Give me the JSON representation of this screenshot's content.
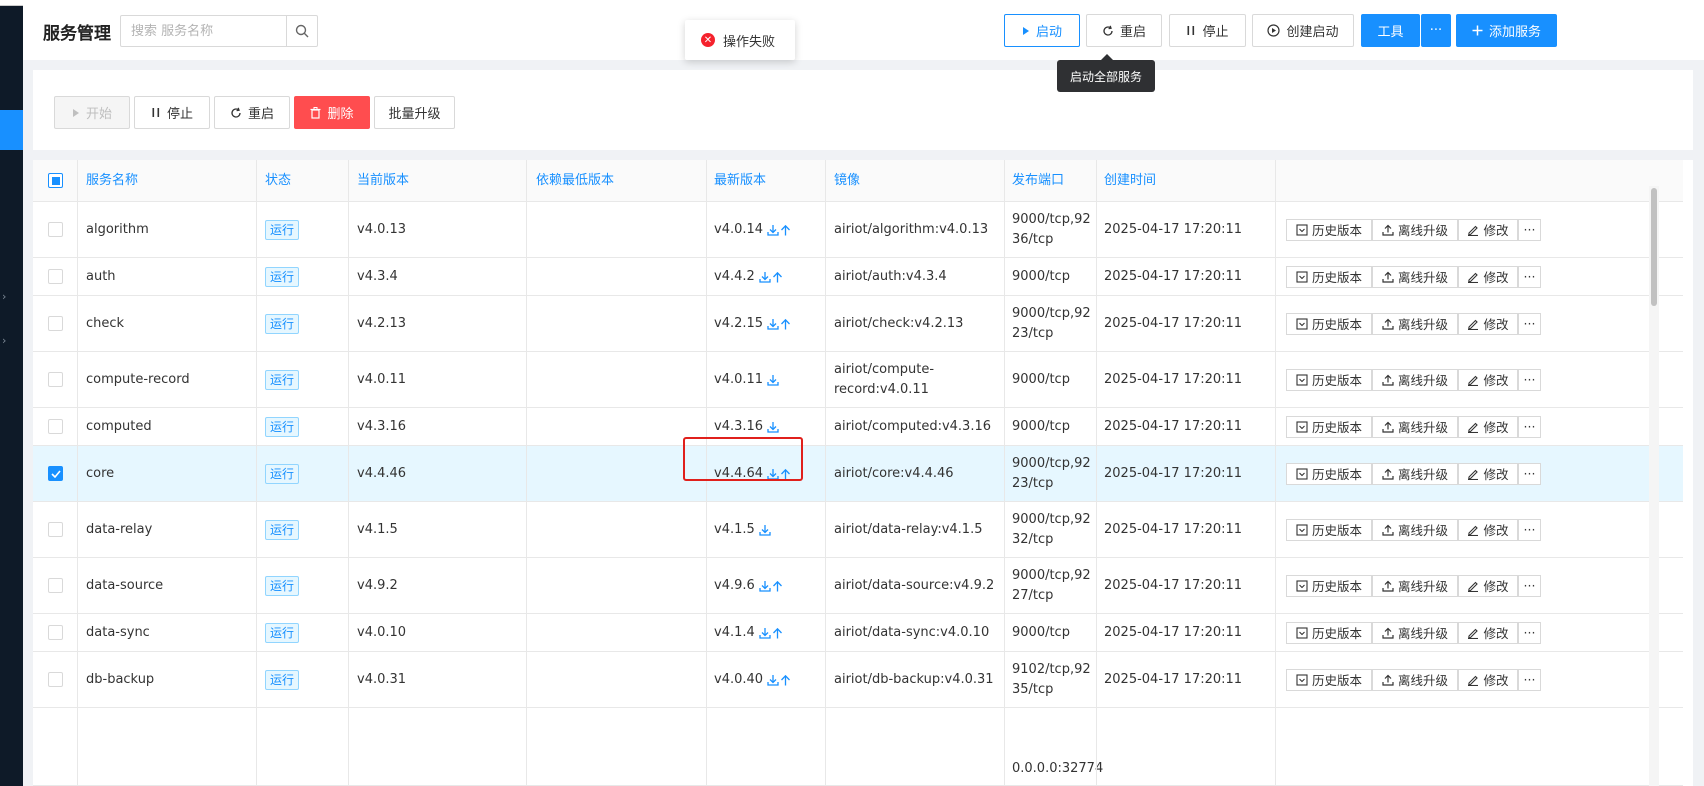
{
  "header": {
    "title": "服务管理",
    "search_placeholder": "搜索 服务名称",
    "buttons": {
      "start": "启动",
      "restart": "重启",
      "stop": "停止",
      "create_start": "创建启动",
      "tools": "工具",
      "more": "···",
      "add_service": "添加服务"
    }
  },
  "toast": {
    "message": "操作失败",
    "type": "error"
  },
  "tooltip": {
    "text": "启动全部服务"
  },
  "toolbar": {
    "start": "开始",
    "stop": "停止",
    "restart": "重启",
    "delete": "删除",
    "batch_upgrade": "批量升级"
  },
  "table": {
    "columns": [
      "服务名称",
      "状态",
      "当前版本",
      "依赖最低版本",
      "最新版本",
      "镜像",
      "发布端口",
      "创建时间"
    ],
    "row_actions": {
      "history": "历史版本",
      "offline_upgrade": "离线升级",
      "edit": "修改",
      "more": "···"
    },
    "rows": [
      {
        "name": "algorithm",
        "status": "运行",
        "current_version": "v4.0.13",
        "min_dep": "",
        "latest_version": "v4.0.14",
        "upgradable": true,
        "image": "airiot/algorithm:v4.0.13",
        "ports": "9000/tcp,9236/tcp",
        "created": "2025-04-17 17:20:11",
        "selected": false
      },
      {
        "name": "auth",
        "status": "运行",
        "current_version": "v4.3.4",
        "min_dep": "",
        "latest_version": "v4.4.2",
        "upgradable": true,
        "image": "airiot/auth:v4.3.4",
        "ports": "9000/tcp",
        "created": "2025-04-17 17:20:11",
        "selected": false
      },
      {
        "name": "check",
        "status": "运行",
        "current_version": "v4.2.13",
        "min_dep": "",
        "latest_version": "v4.2.15",
        "upgradable": true,
        "image": "airiot/check:v4.2.13",
        "ports": "9000/tcp,9223/tcp",
        "created": "2025-04-17 17:20:11",
        "selected": false
      },
      {
        "name": "compute-record",
        "status": "运行",
        "current_version": "v4.0.11",
        "min_dep": "",
        "latest_version": "v4.0.11",
        "upgradable": false,
        "image": "airiot/compute-record:v4.0.11",
        "ports": "9000/tcp",
        "created": "2025-04-17 17:20:11",
        "selected": false
      },
      {
        "name": "computed",
        "status": "运行",
        "current_version": "v4.3.16",
        "min_dep": "",
        "latest_version": "v4.3.16",
        "upgradable": false,
        "image": "airiot/computed:v4.3.16",
        "ports": "9000/tcp",
        "created": "2025-04-17 17:20:11",
        "selected": false
      },
      {
        "name": "core",
        "status": "运行",
        "current_version": "v4.4.46",
        "min_dep": "",
        "latest_version": "v4.4.64",
        "upgradable": true,
        "image": "airiot/core:v4.4.46",
        "ports": "9000/tcp,9223/tcp",
        "created": "2025-04-17 17:20:11",
        "selected": true
      },
      {
        "name": "data-relay",
        "status": "运行",
        "current_version": "v4.1.5",
        "min_dep": "",
        "latest_version": "v4.1.5",
        "upgradable": false,
        "image": "airiot/data-relay:v4.1.5",
        "ports": "9000/tcp,9232/tcp",
        "created": "2025-04-17 17:20:11",
        "selected": false
      },
      {
        "name": "data-source",
        "status": "运行",
        "current_version": "v4.9.2",
        "min_dep": "",
        "latest_version": "v4.9.6",
        "upgradable": true,
        "image": "airiot/data-source:v4.9.2",
        "ports": "9000/tcp,9227/tcp",
        "created": "2025-04-17 17:20:11",
        "selected": false
      },
      {
        "name": "data-sync",
        "status": "运行",
        "current_version": "v4.0.10",
        "min_dep": "",
        "latest_version": "v4.1.4",
        "upgradable": true,
        "image": "airiot/data-sync:v4.0.10",
        "ports": "9000/tcp",
        "created": "2025-04-17 17:20:11",
        "selected": false
      },
      {
        "name": "db-backup",
        "status": "运行",
        "current_version": "v4.0.31",
        "min_dep": "",
        "latest_version": "v4.0.40",
        "upgradable": true,
        "image": "airiot/db-backup:v4.0.31",
        "ports": "9102/tcp,9235/tcp",
        "created": "2025-04-17 17:20:11",
        "selected": false
      },
      {
        "name": "",
        "status": "",
        "current_version": "",
        "min_dep": "",
        "latest_version": "",
        "upgradable": false,
        "image": "",
        "ports": "0.0.0.0:32774",
        "created": "",
        "selected": false
      }
    ]
  },
  "colors": {
    "primary": "#1890ff",
    "danger": "#ff4d4f",
    "highlight": "#e0201c",
    "sidebar": "#0e1a28"
  }
}
